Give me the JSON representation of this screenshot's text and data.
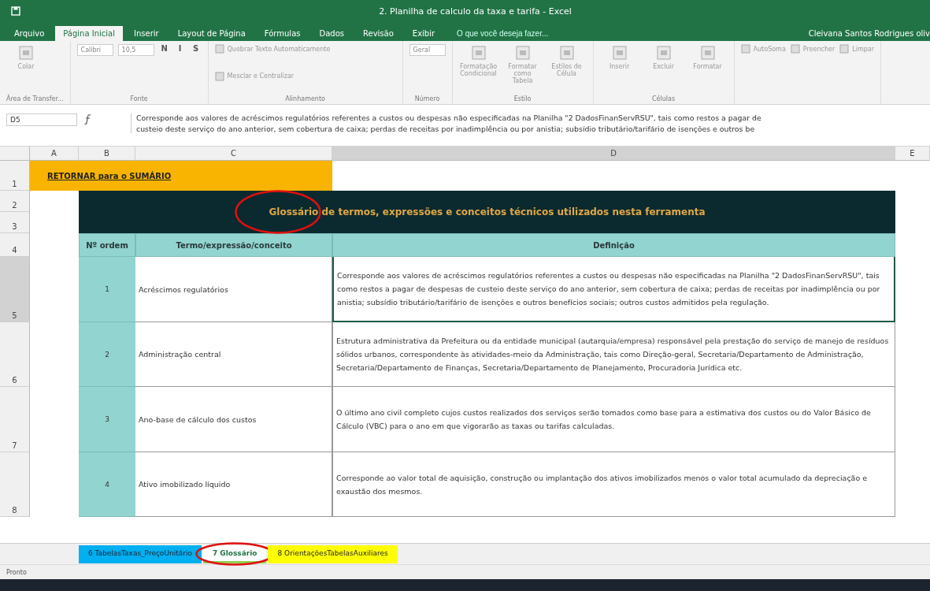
{
  "window": {
    "title": "2. Planilha de calculo da taxa e tarifa - Excel"
  },
  "menu_tabs": [
    {
      "label": "Arquivo",
      "selected": false
    },
    {
      "label": "Página Inicial",
      "selected": true
    },
    {
      "label": "Inserir",
      "selected": false
    },
    {
      "label": "Layout de Página",
      "selected": false
    },
    {
      "label": "Fórmulas",
      "selected": false
    },
    {
      "label": "Dados",
      "selected": false
    },
    {
      "label": "Revisão",
      "selected": false
    },
    {
      "label": "Exibir",
      "selected": false
    }
  ],
  "tell_me": {
    "placeholder": "O que você deseja fazer..."
  },
  "user": "Cleivana Santos Rodrigues oliv",
  "ribbon_groups": [
    {
      "label": "Área de Transfer...",
      "items": [
        {
          "kind": "big",
          "label": "Colar"
        }
      ]
    },
    {
      "label": "Fonte",
      "items": [
        {
          "kind": "field",
          "label": "Calibri"
        },
        {
          "kind": "field",
          "label": "10,5"
        },
        {
          "kind": "glyph",
          "label": "N"
        },
        {
          "kind": "glyph",
          "label": "I"
        },
        {
          "kind": "glyph",
          "label": "S"
        }
      ]
    },
    {
      "label": "Alinhamento",
      "items": [
        {
          "kind": "small",
          "label": "Quebrar Texto Automaticamente"
        },
        {
          "kind": "small",
          "label": "Mesclar e Centralizar"
        }
      ]
    },
    {
      "label": "Número",
      "items": [
        {
          "kind": "field",
          "label": "Geral"
        }
      ]
    },
    {
      "label": "Estilo",
      "items": [
        {
          "kind": "big",
          "label": "Formatação Condicional"
        },
        {
          "kind": "big",
          "label": "Formatar como Tabela"
        },
        {
          "kind": "big",
          "label": "Estilos de Célula"
        }
      ]
    },
    {
      "label": "Células",
      "items": [
        {
          "kind": "big",
          "label": "Inserir"
        },
        {
          "kind": "big",
          "label": "Excluir"
        },
        {
          "kind": "big",
          "label": "Formatar"
        }
      ]
    },
    {
      "items": [
        {
          "kind": "small",
          "label": "AutoSoma"
        },
        {
          "kind": "small",
          "label": "Preencher"
        },
        {
          "kind": "small",
          "label": "Limpar"
        }
      ]
    }
  ],
  "formula_bar": {
    "name_box": "D5",
    "lines": [
      "Corresponde aos valores de acréscimos regulatórios referentes a custos ou despesas não especificadas na Planilha \"2 DadosFinanServRSU\", tais como restos a pagar de",
      "custeio deste serviço do ano anterior, sem cobertura de caixa; perdas de receitas por inadimplência ou por anistia; subsídio tributário/tarifário de isenções e outros be"
    ]
  },
  "columns": [
    {
      "label": "A",
      "selected": false
    },
    {
      "label": "B",
      "selected": false
    },
    {
      "label": "C",
      "selected": false
    },
    {
      "label": "D",
      "selected": true
    },
    {
      "label": "E",
      "selected": false
    }
  ],
  "row_headers": [
    {
      "label": "1",
      "selected": false
    },
    {
      "label": "2",
      "selected": false
    },
    {
      "label": "3",
      "selected": false
    },
    {
      "label": "4",
      "selected": false
    },
    {
      "label": "5",
      "selected": true
    },
    {
      "label": "6",
      "selected": false
    },
    {
      "label": "7",
      "selected": false
    },
    {
      "label": "8",
      "selected": false
    }
  ],
  "return_link": "RETORNAR para o SUMÁRIO",
  "glossary": {
    "title": "Glossário de termos, expressões e conceitos técnicos utilizados nesta ferramenta",
    "circled": true,
    "headers": [
      "Nº ordem",
      "Termo/expressão/conceito",
      "Definição"
    ],
    "entries": [
      {
        "number": "1",
        "term": "Acréscimos regulatórios",
        "definition": "Corresponde aos valores de acréscimos regulatórios referentes a custos ou despesas não especificadas na Planilha \"2 DadosFinanServRSU\", tais como restos a pagar de despesas de custeio deste serviço do ano anterior, sem cobertura de caixa; perdas de receitas por inadimplência ou por anistia; subsídio tributário/tarifário de isenções e outros benefícios sociais; outros custos admitidos pela regulação.",
        "selected": true
      },
      {
        "number": "2",
        "term": "Administração central",
        "definition": "Estrutura administrativa da Prefeitura ou da entidade municipal (autarquia/empresa) responsável pela prestação do serviço de manejo de resíduos sólidos urbanos, correspondente às atividades-meio da Administração, tais como Direção-geral, Secretaria/Departamento de Administração, Secretaria/Departamento de Finanças, Secretaria/Departamento de Planejamento, Procuradoria Jurídica etc.",
        "selected": false
      },
      {
        "number": "3",
        "term": "Ano-base de cálculo dos custos",
        "definition": "O último ano civil completo cujos custos realizados dos serviços serão tomados como base para a estimativa dos custos ou do Valor Básico de Cálculo (VBC) para o ano em que vigorarão as taxas ou tarifas calculadas.",
        "selected": false
      },
      {
        "number": "4",
        "term": "Ativo imobilizado líquido",
        "definition": "Corresponde ao valor total de aquisição, construção ou implantação dos ativos imobilizados menos o valor total acumulado da depreciação e exaustão dos mesmos.",
        "selected": false
      }
    ]
  },
  "sheet_tabs": [
    {
      "label": "6 TabelasTaxas_PreçoUnitário",
      "color": "#00b0f0",
      "selected": false,
      "circled": false
    },
    {
      "label": "7 Glossário",
      "color": "#92d050",
      "selected": true,
      "circled": true
    },
    {
      "label": "8 OrientaçõesTabelasAuxiliares",
      "color": "#ffff00",
      "selected": false,
      "circled": false
    }
  ],
  "status": "Pronto"
}
